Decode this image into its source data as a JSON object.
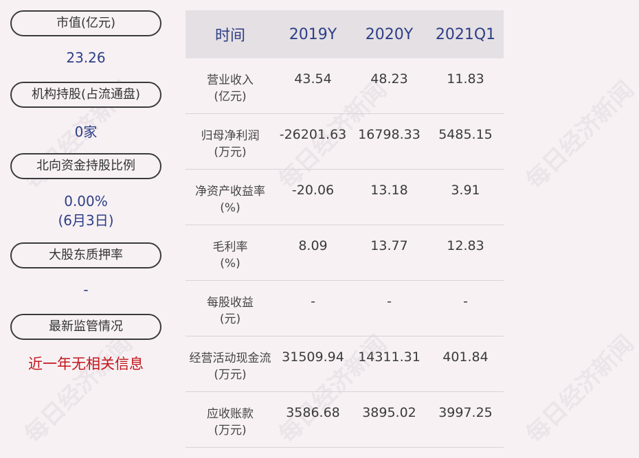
{
  "left": {
    "items": [
      {
        "label": "市值(亿元)",
        "value": "23.26"
      },
      {
        "label": "机构持股(占流通盘)",
        "value": "0家"
      },
      {
        "label": "北向资金持股比例",
        "value": "0.00%",
        "value2": "(6月3日)"
      },
      {
        "label": "大股东质押率",
        "value": "-"
      },
      {
        "label": "最新监管情况",
        "value": "近一年无相关信息"
      }
    ],
    "highlight_color": "#c4161c",
    "value_color": "#2d3e87"
  },
  "table": {
    "headers": [
      "时间",
      "2019Y",
      "2020Y",
      "2021Q1"
    ],
    "rows": [
      {
        "label1": "营业收入",
        "label2": "(亿元)",
        "values": [
          "43.54",
          "48.23",
          "11.83"
        ]
      },
      {
        "label1": "归母净利润",
        "label2": "(万元)",
        "values": [
          "-26201.63",
          "16798.33",
          "5485.15"
        ]
      },
      {
        "label1": "净资产收益率",
        "label2": "(%)",
        "values": [
          "-20.06",
          "13.18",
          "3.91"
        ]
      },
      {
        "label1": "毛利率",
        "label2": "(%)",
        "values": [
          "8.09",
          "13.77",
          "12.83"
        ]
      },
      {
        "label1": "每股收益",
        "label2": "(元)",
        "values": [
          "-",
          "-",
          "-"
        ]
      },
      {
        "label1": "经营活动现金流",
        "label2": "(万元)",
        "values": [
          "31509.94",
          "14311.31",
          "401.84"
        ]
      },
      {
        "label1": "应收账款",
        "label2": "(万元)",
        "values": [
          "3586.68",
          "3895.02",
          "3997.25"
        ]
      }
    ]
  },
  "watermark": "每日经济新闻"
}
